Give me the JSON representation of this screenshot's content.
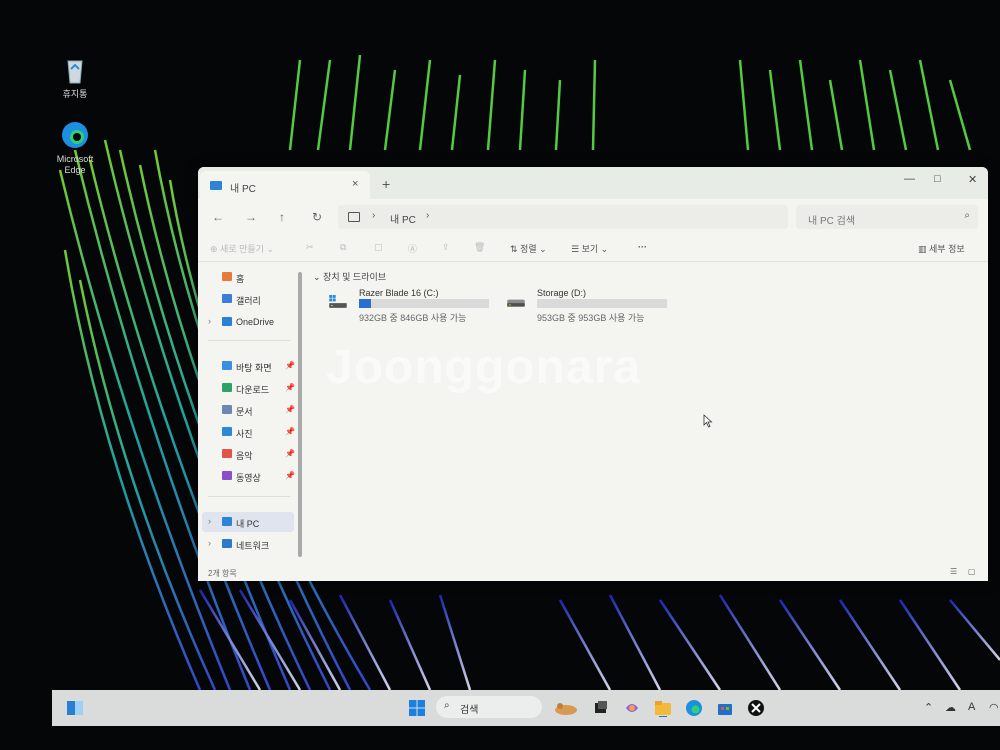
{
  "desktop": {
    "icons": [
      {
        "label": "휴지통"
      },
      {
        "label": "Microsoft Edge"
      }
    ]
  },
  "window": {
    "tab_title": "내 PC",
    "tab_close": "×",
    "new_tab": "+",
    "controls": {
      "minimize": "—",
      "maximize": "□",
      "close": "✕"
    },
    "nav": {
      "back": "←",
      "forward": "→",
      "up": "↑",
      "refresh": "↻"
    },
    "address": {
      "separator": "›",
      "crumb": "내 PC"
    },
    "search_placeholder": "내 PC 검색",
    "commandbar": {
      "new_label": "새로 만들기",
      "sort_label": "정렬",
      "view_label": "보기",
      "more_label": "···",
      "details_label": "세부 정보"
    },
    "sidebar": {
      "items": [
        {
          "label": "홈"
        },
        {
          "label": "갤러리"
        },
        {
          "label": "OneDrive"
        },
        {
          "label": "바탕 화면"
        },
        {
          "label": "다운로드"
        },
        {
          "label": "문서"
        },
        {
          "label": "사진"
        },
        {
          "label": "음악"
        },
        {
          "label": "동영상"
        },
        {
          "label": "내 PC"
        },
        {
          "label": "네트워크"
        }
      ]
    },
    "group_header": "장치 및 드라이브",
    "drives": [
      {
        "name": "Razer Blade 16 (C:)",
        "info": "932GB 중 846GB 사용 가능",
        "used_fraction": 0.092,
        "bar_color": "#2b6fd1"
      },
      {
        "name": "Storage (D:)",
        "info": "953GB 중 953GB 사용 가능",
        "used_fraction": 0.0,
        "bar_color": "#2b6fd1"
      }
    ],
    "status": {
      "count": "2개 항목"
    }
  },
  "watermark": "Joonggonara",
  "taskbar": {
    "search_placeholder": "검색"
  }
}
